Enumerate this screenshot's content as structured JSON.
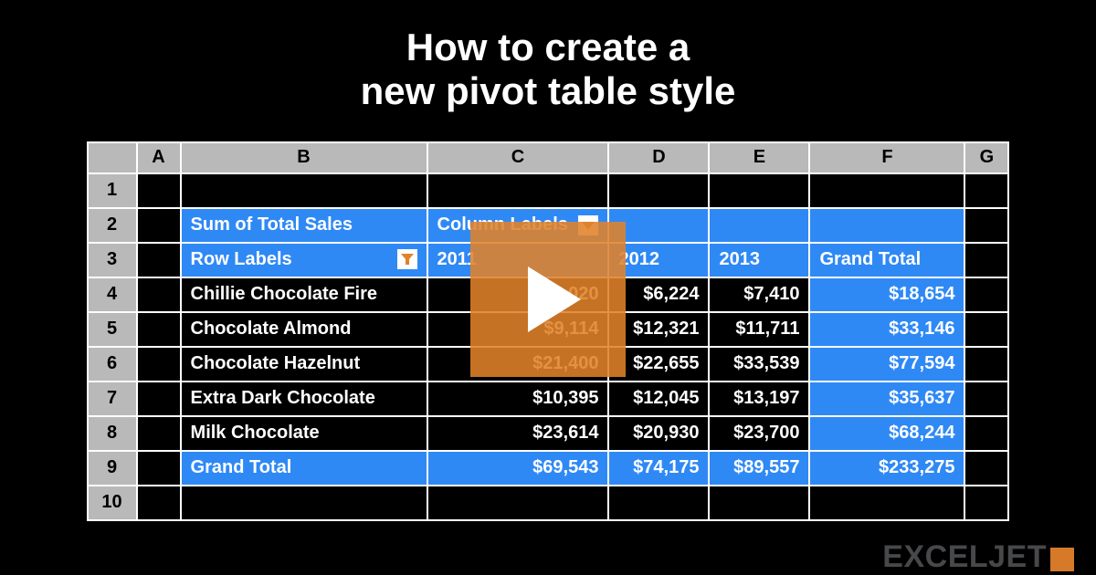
{
  "title_line1": "How to create a",
  "title_line2": "new pivot table style",
  "columns": {
    "A": "A",
    "B": "B",
    "C": "C",
    "D": "D",
    "E": "E",
    "F": "F",
    "G": "G"
  },
  "rownums": {
    "r1": "1",
    "r2": "2",
    "r3": "3",
    "r4": "4",
    "r5": "5",
    "r6": "6",
    "r7": "7",
    "r8": "8",
    "r9": "9",
    "r10": "10"
  },
  "pivot": {
    "sum_label": "Sum of Total Sales",
    "column_labels": "Column Labels",
    "row_labels": "Row Labels",
    "years": {
      "y1": "2011",
      "y2": "2012",
      "y3": "2013"
    },
    "grand_total_col": "Grand Total",
    "rows": [
      {
        "label": "Chillie Chocolate Fire",
        "y1": "$5,020",
        "y2": "$6,224",
        "y3": "$7,410",
        "total": "$18,654"
      },
      {
        "label": "Chocolate Almond",
        "y1": "$9,114",
        "y2": "$12,321",
        "y3": "$11,711",
        "total": "$33,146"
      },
      {
        "label": "Chocolate Hazelnut",
        "y1": "$21,400",
        "y2": "$22,655",
        "y3": "$33,539",
        "total": "$77,594"
      },
      {
        "label": "Extra Dark Chocolate",
        "y1": "$10,395",
        "y2": "$12,045",
        "y3": "$13,197",
        "total": "$35,637"
      },
      {
        "label": "Milk Chocolate",
        "y1": "$23,614",
        "y2": "$20,930",
        "y3": "$23,700",
        "total": "$68,244"
      }
    ],
    "grand_total_row": {
      "label": "Grand Total",
      "y1": "$69,543",
      "y2": "$74,175",
      "y3": "$89,557",
      "total": "$233,275"
    }
  },
  "brand": "EXCELJET",
  "icons": {
    "filter": "filter-dropdown-icon",
    "play": "play-icon"
  },
  "colors": {
    "accent": "#2f89f5",
    "filter": "#e0822a"
  }
}
